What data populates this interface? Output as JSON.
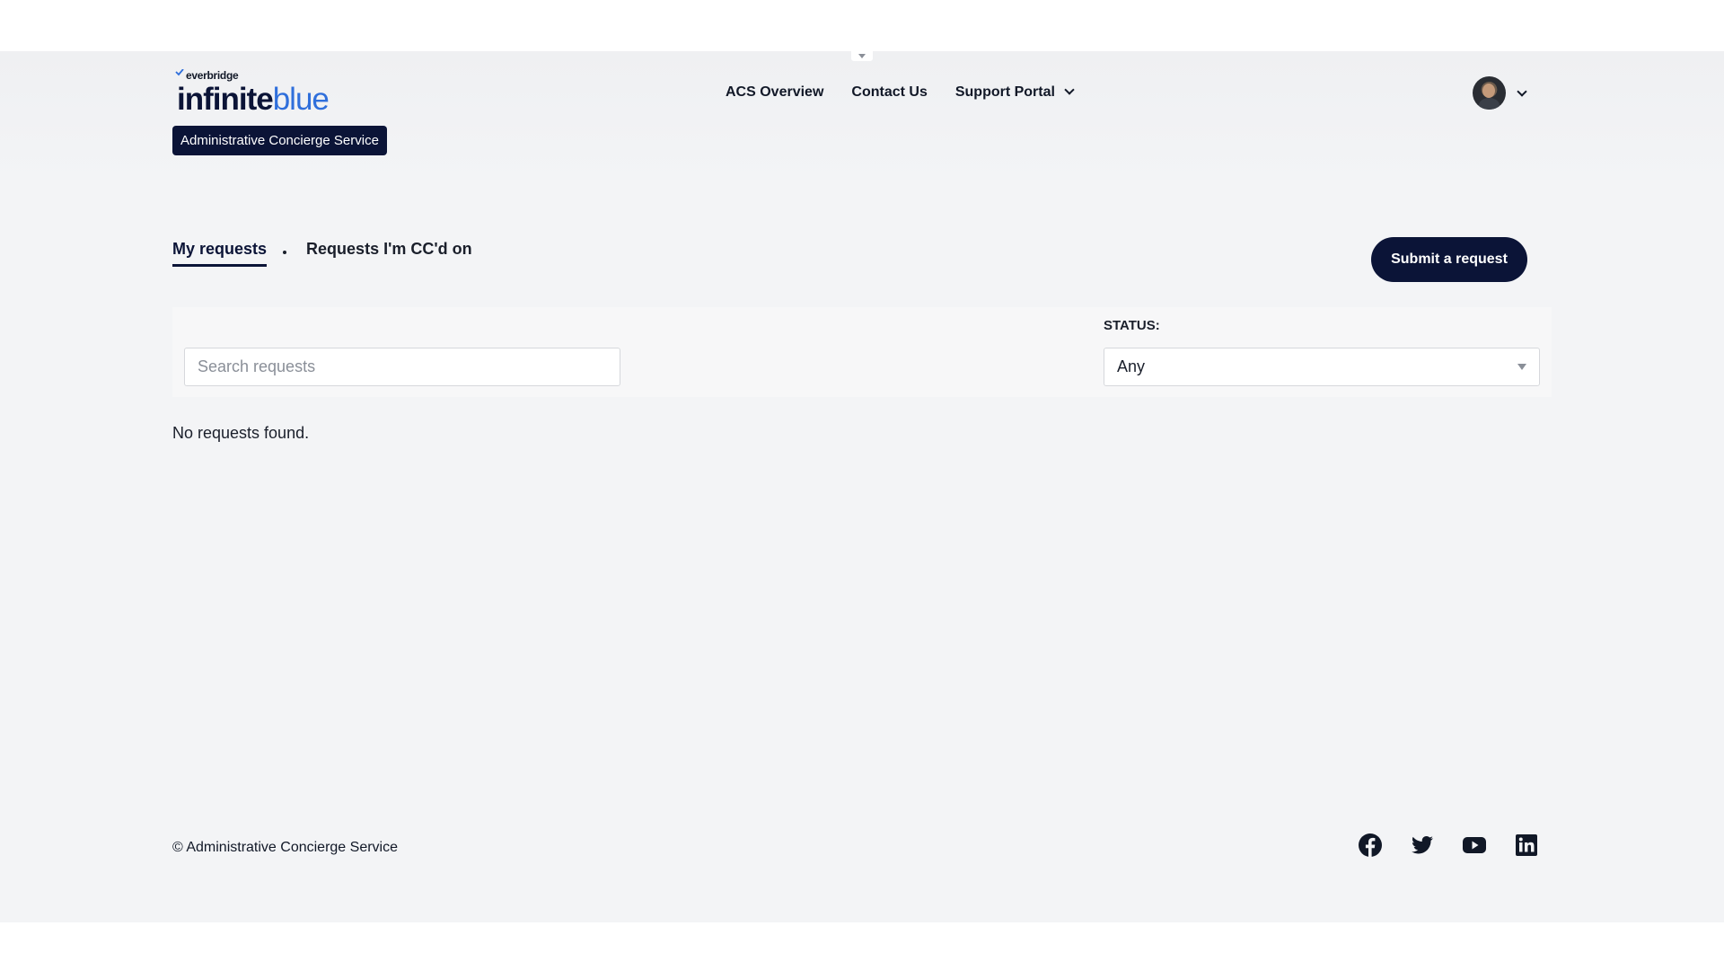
{
  "header": {
    "logo": {
      "brand_small": "everbridge",
      "brand_dark": "infinite",
      "brand_blue": "blue"
    },
    "badge": "Administrative Concierge Service",
    "nav": [
      {
        "label": "ACS Overview"
      },
      {
        "label": "Contact Us"
      },
      {
        "label": "Support Portal"
      }
    ]
  },
  "tabs": [
    {
      "label": "My requests",
      "active": true
    },
    {
      "label": "Requests I'm CC'd on",
      "active": false
    }
  ],
  "actions": {
    "submit_label": "Submit a request"
  },
  "filters": {
    "search_placeholder": "Search requests",
    "status_label": "STATUS:",
    "status_value": "Any"
  },
  "results": {
    "empty_message": "No requests found."
  },
  "footer": {
    "copyright": "© Administrative Concierge Service",
    "social": [
      "facebook-icon",
      "twitter-icon",
      "youtube-icon",
      "linkedin-icon"
    ]
  },
  "colors": {
    "brand_navy": "#0b1437",
    "brand_blue": "#2f6fdb",
    "page_bg": "#f3f4f6"
  }
}
